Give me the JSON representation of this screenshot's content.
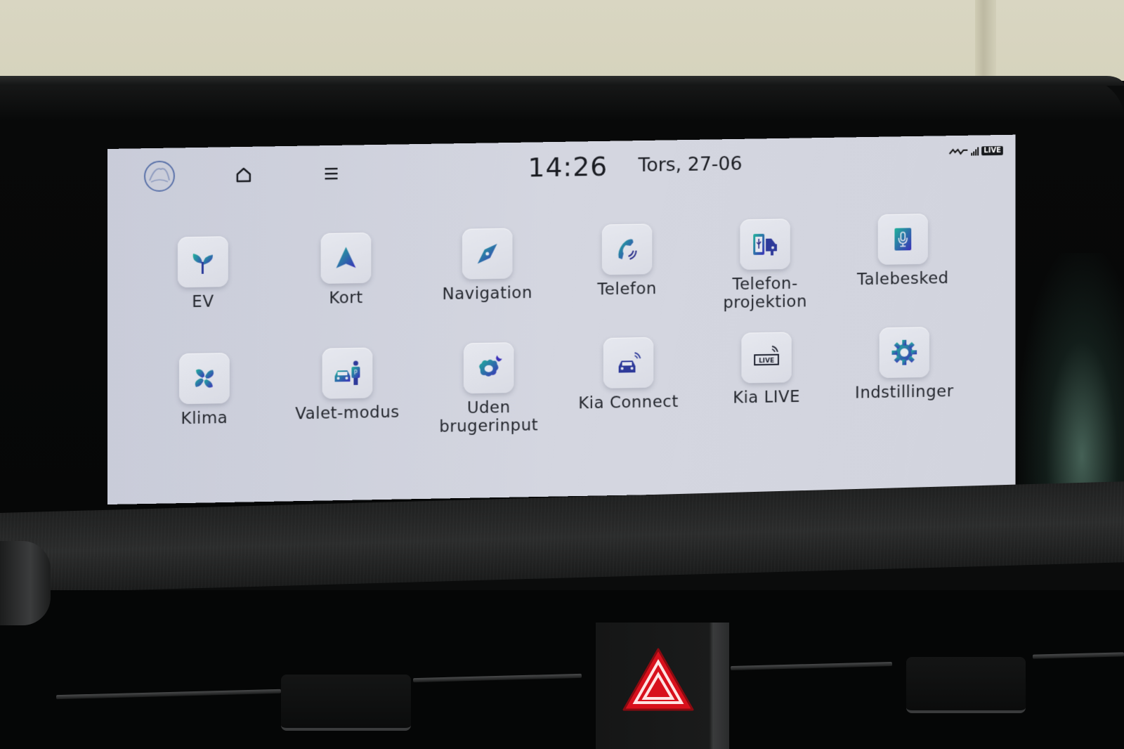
{
  "statusbar": {
    "time": "14:26",
    "date": "Tors, 27-06",
    "live_badge": "LIVE",
    "icons": [
      "kia-logo-icon",
      "home-icon",
      "menu-icon",
      "kia-brand-icon",
      "signal-icon",
      "live-icon"
    ]
  },
  "apps": [
    {
      "id": "ev",
      "label": "EV",
      "icon": "sprout-icon"
    },
    {
      "id": "kort",
      "label": "Kort",
      "icon": "map-arrow-icon"
    },
    {
      "id": "navigation",
      "label": "Navigation",
      "icon": "compass-icon"
    },
    {
      "id": "telefon",
      "label": "Telefon",
      "icon": "phone-icon"
    },
    {
      "id": "telefon-projektion",
      "label": "Telefon-\nprojektion",
      "icon": "phone-projection-icon"
    },
    {
      "id": "talebesked",
      "label": "Talebesked",
      "icon": "microphone-icon"
    },
    {
      "id": "klima",
      "label": "Klima",
      "icon": "fan-icon"
    },
    {
      "id": "valet-modus",
      "label": "Valet-modus",
      "icon": "valet-icon"
    },
    {
      "id": "uden-brugerinput",
      "label": "Uden\nbrugerinput",
      "icon": "sleep-mode-icon"
    },
    {
      "id": "kia-connect",
      "label": "Kia Connect",
      "icon": "connected-car-icon"
    },
    {
      "id": "kia-live",
      "label": "Kia LIVE",
      "icon": "live-service-icon"
    },
    {
      "id": "indstillinger",
      "label": "Indstillinger",
      "icon": "gear-icon"
    }
  ],
  "icon_live_text": "LIVE",
  "valet_sign": "P",
  "colors": {
    "icon_gradient_start": "#1fb39a",
    "icon_gradient_end": "#3a2fb8",
    "hazard_red": "#d8101c",
    "screen_bg": "#d0d3de",
    "text": "#24272e"
  }
}
